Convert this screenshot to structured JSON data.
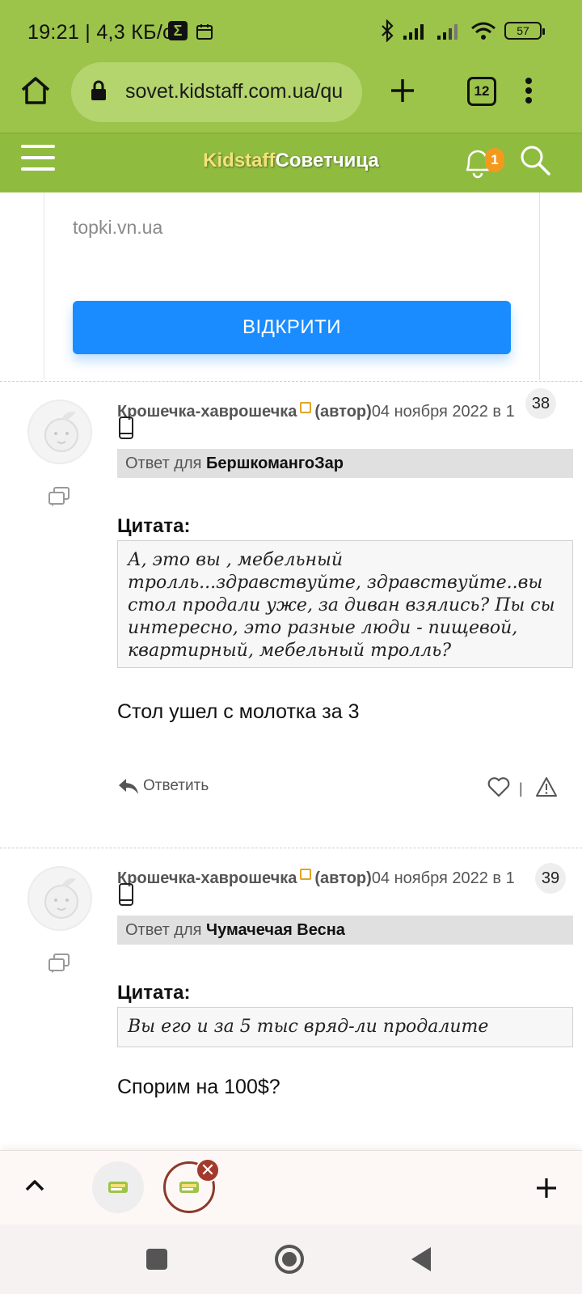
{
  "status_bar": {
    "time_speed": "19:21 | 4,3 КБ/с",
    "battery": "57"
  },
  "browser": {
    "url": "sovet.kidstaff.com.ua/qu",
    "tab_count": "12"
  },
  "site_header": {
    "logo_part1": "Kidstaff",
    "logo_part2": "Советчица",
    "notification_count": "1"
  },
  "ad": {
    "domain": "topki.vn.ua",
    "button_label": "ВІДКРИТИ"
  },
  "posts": [
    {
      "author": "Крошечка-хаврошечка",
      "author_tag": "(автор)",
      "date": "04 ноября 2022 в 1",
      "number": "38",
      "reply_prefix": "Ответ для ",
      "reply_to": "БершкомангоЗар",
      "quote_label": "Цитата:",
      "quote": "А, это вы , мебельный тролль...здравствуйте, здравствуйте..вы стол продали уже, за диван взялись? Пы сы интересно, это разные люди - пищевой, квартирный, мебельный тролль?",
      "body": "Стол ушел с молотка за 3",
      "reply_label": "Ответить",
      "action_separator": "|"
    },
    {
      "author": "Крошечка-хаврошечка",
      "author_tag": "(автор)",
      "date": "04 ноября 2022 в 1",
      "number": "39",
      "reply_prefix": "Ответ для ",
      "reply_to": "Чумачечая Весна",
      "quote_label": "Цитата:",
      "quote": "Вы его и за 5 тыс вряд-ли продалите",
      "body": "Спорим на 100$?"
    }
  ],
  "tab_strip": {
    "close_symbol": "✕"
  },
  "colors": {
    "browser_green": "#9cc34a",
    "header_green": "#8fbc3f",
    "button_blue": "#1a8cff",
    "notification_orange": "#f39a1e",
    "tab_close_red": "#a23a2c"
  },
  "icons": [
    "home-icon",
    "lock-icon",
    "plus-icon",
    "tabs-icon",
    "more-icon",
    "menu-icon",
    "bell-icon",
    "search-icon",
    "mobile-device-icon",
    "chat-icon",
    "reply-arrow-icon",
    "heart-icon",
    "warning-icon",
    "chevron-up-icon",
    "square-icon",
    "circle-icon",
    "back-triangle-icon"
  ]
}
